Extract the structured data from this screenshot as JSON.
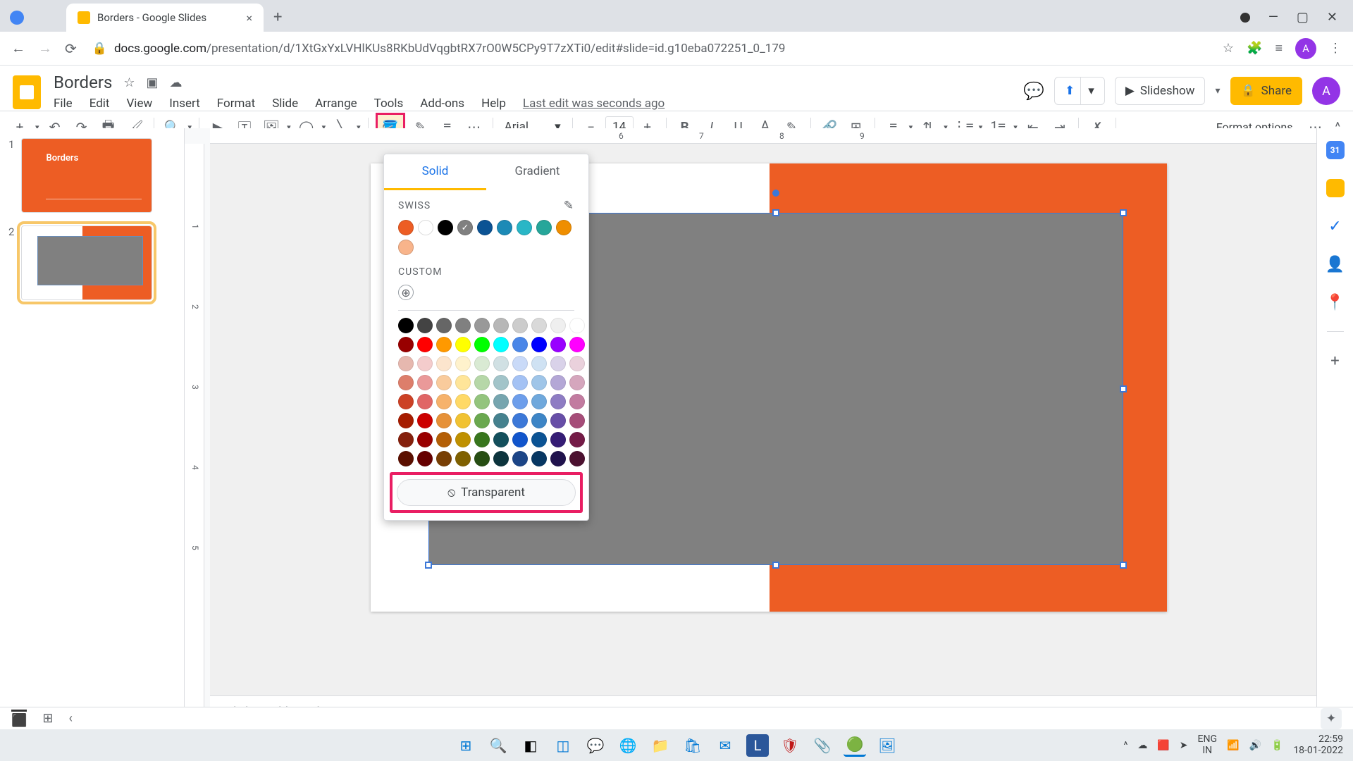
{
  "browser": {
    "tab_title": "Borders - Google Slides",
    "url_prefix": "docs.google.com",
    "url_rest": "/presentation/d/1XtGxYxLVHlKUs8RKbUdVqgbtRX7rO0W5CPy9T7zXTi0/edit#slide=id.g10eba072251_0_179",
    "avatar_letter": "A"
  },
  "doc": {
    "title": "Borders",
    "menus": [
      "File",
      "Edit",
      "View",
      "Insert",
      "Format",
      "Slide",
      "Arrange",
      "Tools",
      "Add-ons",
      "Help"
    ],
    "last_edit": "Last edit was seconds ago",
    "slideshow": "Slideshow",
    "share": "Share"
  },
  "toolbar": {
    "font": "Arial",
    "font_size": "14",
    "format_options": "Format options"
  },
  "slides": {
    "items": [
      {
        "num": "1",
        "title": "Borders"
      },
      {
        "num": "2",
        "title": ""
      }
    ]
  },
  "ruler_marks": [
    "6",
    "7",
    "8",
    "9"
  ],
  "notes_placeholder": "Click to add speaker notes",
  "color_popup": {
    "tab_solid": "Solid",
    "tab_gradient": "Gradient",
    "section_swiss": "SWISS",
    "section_custom": "CUSTOM",
    "transparent": "Transparent",
    "swiss_colors": [
      "#ed5d24",
      "#ffffff",
      "#000000",
      "#808080",
      "#0b5394",
      "#1c8ab6",
      "#29b6c6",
      "#26a69a",
      "#ef8e00",
      "#f8b48b"
    ],
    "grid_colors": [
      "#000000",
      "#434343",
      "#666666",
      "#808080",
      "#999999",
      "#b7b7b7",
      "#cccccc",
      "#d9d9d9",
      "#efefef",
      "#ffffff",
      "#980000",
      "#ff0000",
      "#ff9900",
      "#ffff00",
      "#00ff00",
      "#00ffff",
      "#4a86e8",
      "#0000ff",
      "#9900ff",
      "#ff00ff",
      "#e6b8af",
      "#f4cccc",
      "#fce5cd",
      "#fff2cc",
      "#d9ead3",
      "#d0e0e3",
      "#c9daf8",
      "#cfe2f3",
      "#d9d2e9",
      "#ead1dc",
      "#dd7e6b",
      "#ea9999",
      "#f9cb9c",
      "#ffe599",
      "#b6d7a8",
      "#a2c4c9",
      "#a4c2f4",
      "#9fc5e8",
      "#b4a7d6",
      "#d5a6bd",
      "#cc4125",
      "#e06666",
      "#f6b26b",
      "#ffd966",
      "#93c47d",
      "#76a5af",
      "#6d9eeb",
      "#6fa8dc",
      "#8e7cc3",
      "#c27ba0",
      "#a61c00",
      "#cc0000",
      "#e69138",
      "#f1c232",
      "#6aa84f",
      "#45818e",
      "#3c78d8",
      "#3d85c6",
      "#674ea7",
      "#a64d79",
      "#85200c",
      "#990000",
      "#b45f06",
      "#bf9000",
      "#38761d",
      "#134f5c",
      "#1155cc",
      "#0b5394",
      "#351c75",
      "#741b47",
      "#5b0f00",
      "#660000",
      "#783f04",
      "#7f6000",
      "#274e13",
      "#0c343d",
      "#1c4587",
      "#073763",
      "#20124d",
      "#4c1130"
    ]
  },
  "side_panel": {
    "cal": "31"
  },
  "taskbar": {
    "lang1": "ENG",
    "lang2": "IN",
    "time": "22:59",
    "date": "18-01-2022"
  }
}
